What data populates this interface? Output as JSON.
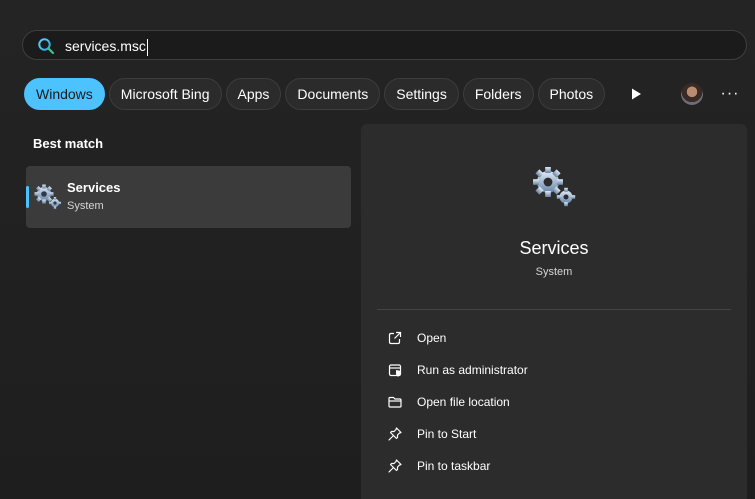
{
  "search": {
    "value": "services.msc",
    "icon": "search-icon"
  },
  "tabs": [
    {
      "label": "Windows",
      "active": true
    },
    {
      "label": "Microsoft Bing",
      "active": false
    },
    {
      "label": "Apps",
      "active": false
    },
    {
      "label": "Documents",
      "active": false
    },
    {
      "label": "Settings",
      "active": false
    },
    {
      "label": "Folders",
      "active": false
    },
    {
      "label": "Photos",
      "active": false
    }
  ],
  "best_match": {
    "heading": "Best match",
    "title": "Services",
    "subtitle": "System"
  },
  "detail": {
    "title": "Services",
    "subtitle": "System",
    "actions": [
      {
        "label": "Open",
        "icon": "open-external-icon"
      },
      {
        "label": "Run as administrator",
        "icon": "shield-admin-icon"
      },
      {
        "label": "Open file location",
        "icon": "folder-icon"
      },
      {
        "label": "Pin to Start",
        "icon": "pin-icon"
      },
      {
        "label": "Pin to taskbar",
        "icon": "pin-icon"
      }
    ]
  },
  "colors": {
    "accent": "#4cc2ff",
    "background": "#202020",
    "panel": "#2c2c2c",
    "selected_row": "#3b3b3b"
  }
}
